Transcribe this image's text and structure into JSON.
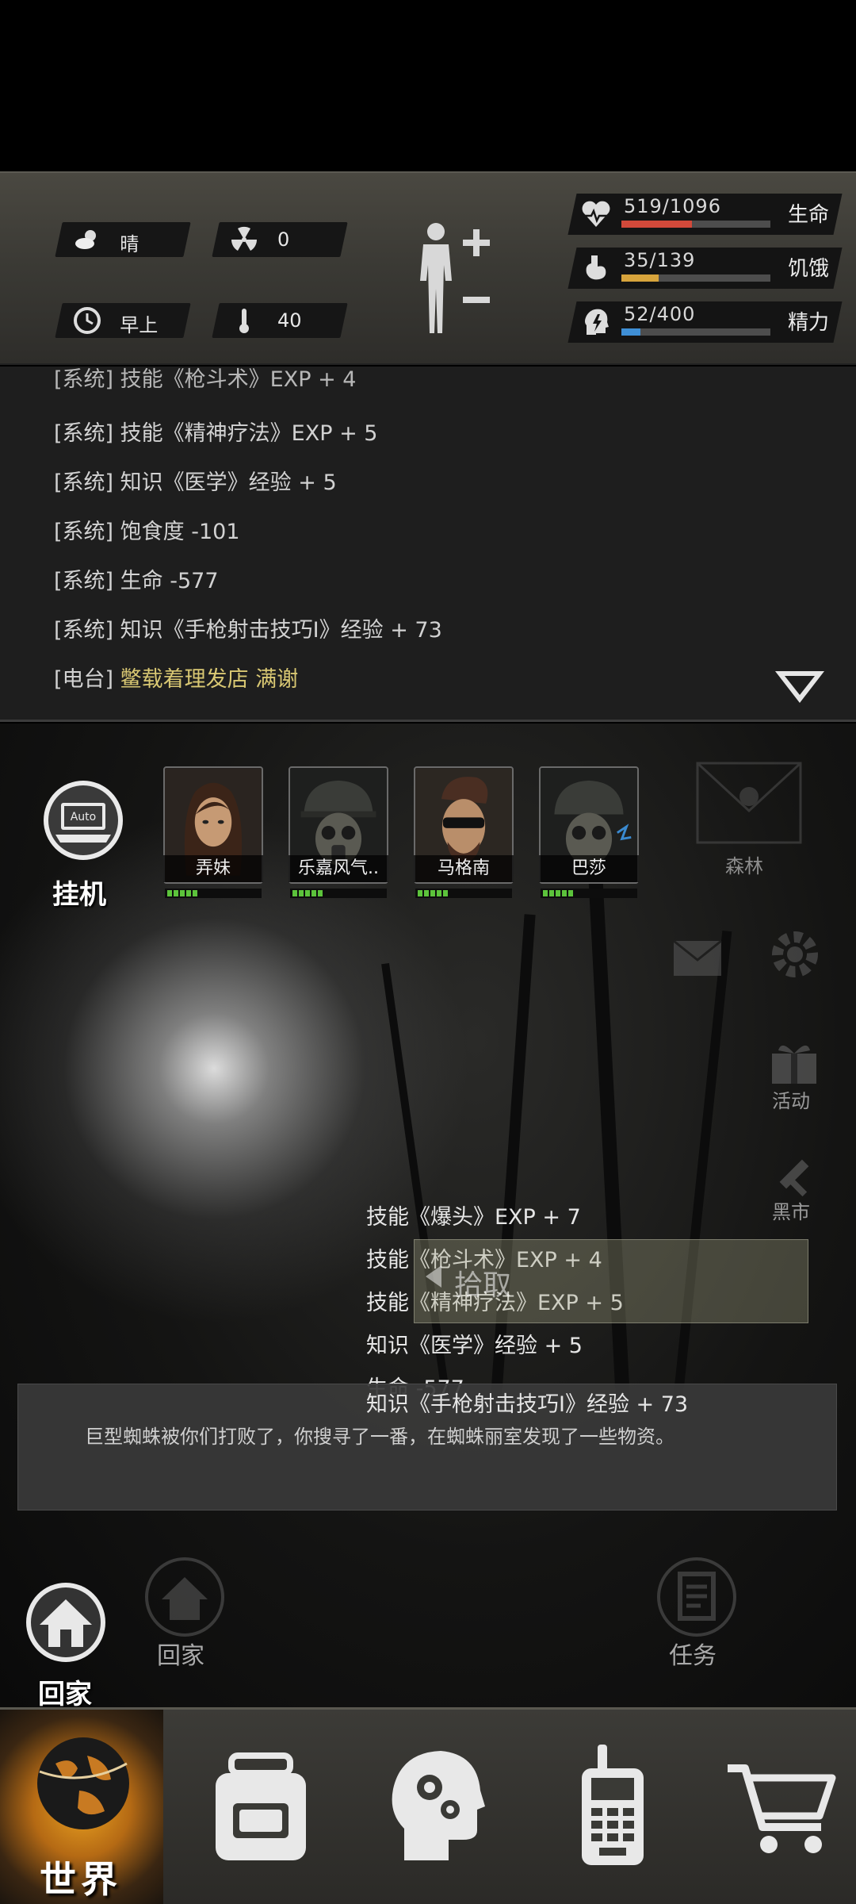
{
  "status": {
    "weather": "晴",
    "radiation": "0",
    "time_of_day": "早上",
    "temperature": "40"
  },
  "vitals": [
    {
      "value": "519/1096",
      "label": "生命",
      "fraction": 0.473,
      "color": "#d2493a"
    },
    {
      "value": "35/139",
      "label": "饥饿",
      "fraction": 0.252,
      "color": "#d7a43c"
    },
    {
      "value": "52/400",
      "label": "精力",
      "fraction": 0.13,
      "color": "#3f8fd6"
    }
  ],
  "log": {
    "partial_line": "[系统] 技能《枪斗术》EXP + 4",
    "lines": [
      {
        "tag": "[系统]",
        "text": " 技能《精神疗法》EXP + 5"
      },
      {
        "tag": "[系统]",
        "text": " 知识《医学》经验 + 5"
      },
      {
        "tag": "[系统]",
        "text": " 饱食度 -101"
      },
      {
        "tag": "[系统]",
        "text": " 生命 -577"
      },
      {
        "tag": "[系统]",
        "text": " 知识《手枪射击技巧Ⅰ》经验 + 73"
      },
      {
        "tag": "[电台]",
        "text": " 鳖载着理发店 满谢"
      }
    ]
  },
  "auto": {
    "badge": "Auto",
    "label": "挂机"
  },
  "party": [
    {
      "name": "弄妹",
      "health": 0.75
    },
    {
      "name": "乐嘉风气..",
      "health": 0.8
    },
    {
      "name": "马格南",
      "health": 0.8
    },
    {
      "name": "巴莎",
      "health": 0.75
    }
  ],
  "location": "森林",
  "side_buttons": {
    "events": "活动",
    "market": "黑市"
  },
  "loot": [
    "技能《爆头》EXP + 7",
    "技能《枪斗术》EXP + 4",
    "技能《精神疗法》EXP + 5",
    "知识《医学》经验 + 5",
    "生命 -577",
    "知识《手枪射击技巧Ⅰ》经验 + 73"
  ],
  "pickup_label": "拾取",
  "message": "巨型蜘蛛被你们打败了，你搜寻了一番，在蜘蛛丽室发现了一些物资。",
  "home_label": "回家",
  "ghost_home_label": "回家",
  "ghost_task_label": "任务",
  "nav": {
    "world_label": "世界"
  }
}
